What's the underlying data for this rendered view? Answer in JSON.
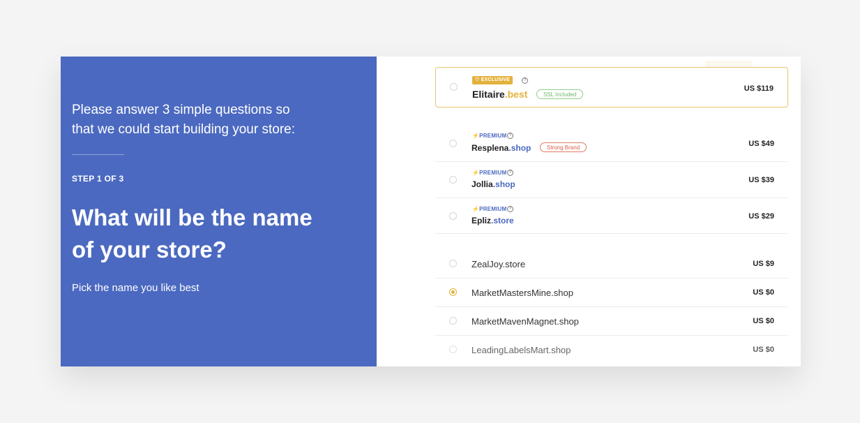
{
  "left": {
    "intro": "Please answer 3 simple questions so that we could start building your store:",
    "step": "STEP 1 OF 3",
    "question": "What will be the name of your store?",
    "hint": "Pick the name you like best"
  },
  "exclusive": {
    "badge": "EXCLUSIVE",
    "name": "Elitaire",
    "tld": ".best",
    "tag": "SSL Included",
    "price": "US $119"
  },
  "premium": [
    {
      "badge": "PREMIUM",
      "name": "Resplena",
      "tld": ".shop",
      "tag": "Strong Brand",
      "price": "US $49"
    },
    {
      "badge": "PREMIUM",
      "name": "Jollia",
      "tld": ".shop",
      "tag": "",
      "price": "US $39"
    },
    {
      "badge": "PREMIUM",
      "name": "Epliz",
      "tld": ".store",
      "tag": "",
      "price": "US $29"
    }
  ],
  "standard": [
    {
      "name": "ZealJoy.store",
      "price": "US $9",
      "selected": false
    },
    {
      "name": "MarketMastersMine.shop",
      "price": "US $0",
      "selected": true
    },
    {
      "name": "MarketMavenMagnet.shop",
      "price": "US $0",
      "selected": false
    },
    {
      "name": "LeadingLabelsMart.shop",
      "price": "US $0",
      "selected": false
    }
  ],
  "icons": {
    "help": "question-circle-icon",
    "premium": "lightning-icon",
    "exclusive": "diamond-icon"
  },
  "colors": {
    "accent_blue": "#4b69c0",
    "gold": "#e3b23c",
    "brand_red": "#d9604a",
    "ssl_green": "#6bb96b"
  }
}
